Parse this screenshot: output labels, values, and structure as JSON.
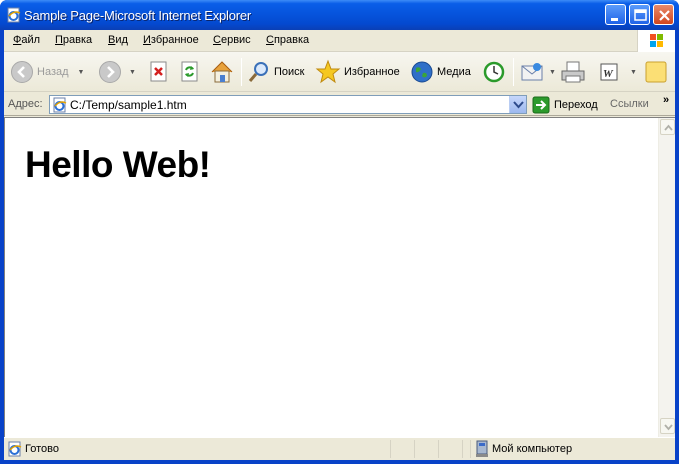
{
  "window": {
    "title": "Sample Page-Microsoft Internet Explorer"
  },
  "menu": {
    "items": [
      "Файл",
      "Правка",
      "Вид",
      "Избранное",
      "Сервис",
      "Справка"
    ]
  },
  "toolbar": {
    "back_label": "Назад",
    "search_label": "Поиск",
    "favorites_label": "Избранное",
    "media_label": "Медиа"
  },
  "address": {
    "label": "Адрес:",
    "value": "C:/Temp/sample1.htm",
    "go_label": "Переход",
    "links_label": "Ссылки",
    "links_chevron": "»"
  },
  "page": {
    "heading": "Hello Web!"
  },
  "status": {
    "text": "Готово",
    "zone": "Мой компьютер"
  },
  "colors": {
    "titlebar": "#0654dd",
    "chrome": "#ece9d8",
    "close_button": "#d2461d"
  }
}
